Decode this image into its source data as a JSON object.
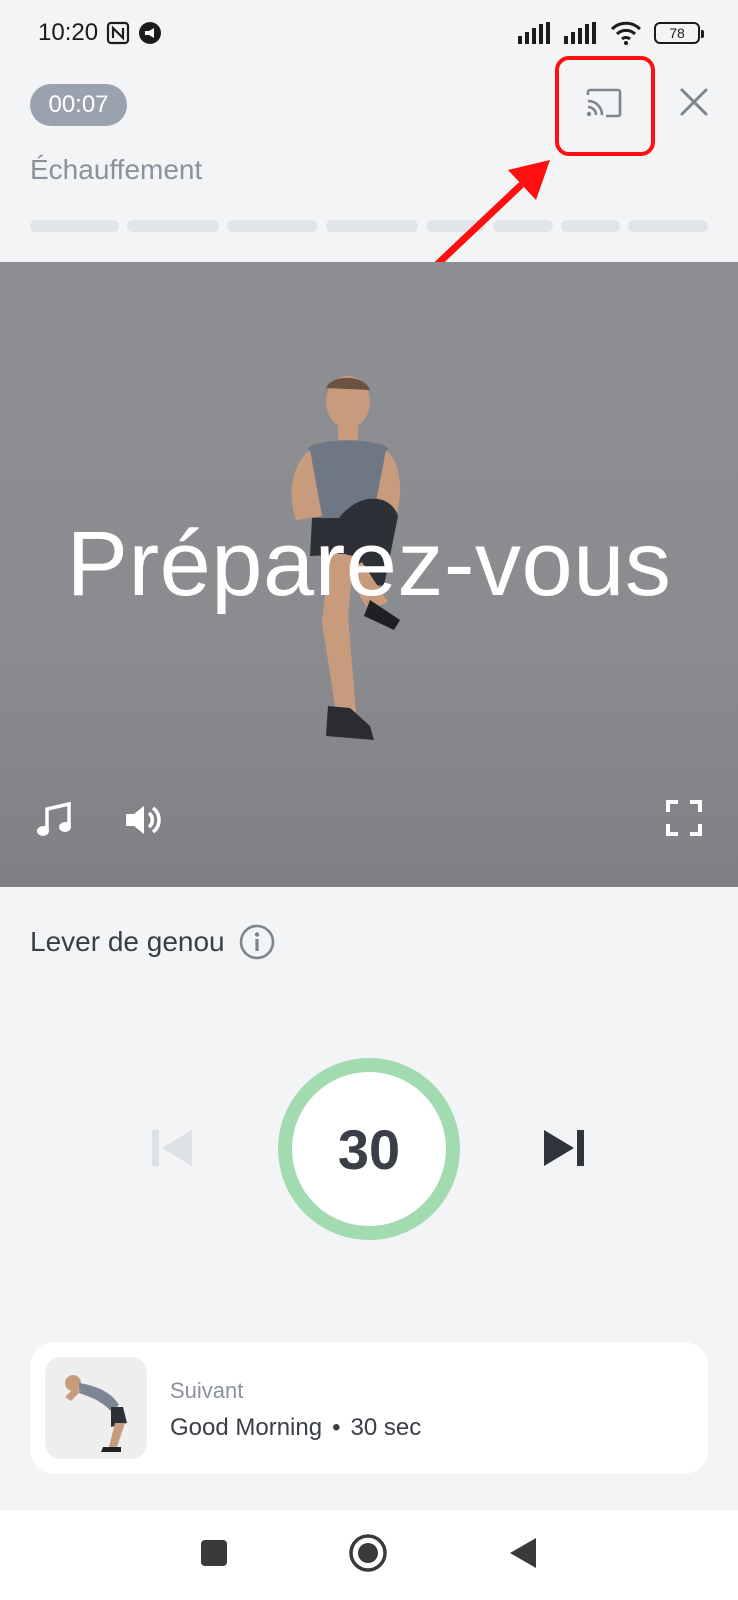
{
  "status_bar": {
    "time": "10:20",
    "battery": "78"
  },
  "header": {
    "timer": "00:07",
    "section": "Échauffement",
    "progress_segments": 8
  },
  "video": {
    "overlay_text": "Préparez-vous"
  },
  "exercise": {
    "name": "Lever de genou"
  },
  "countdown": {
    "value": "30"
  },
  "next": {
    "label": "Suivant",
    "name": "Good Morning",
    "separator": "•",
    "duration": "30 sec"
  },
  "colors": {
    "highlight": "#ff1010",
    "timer_ring": "#a3dbb0",
    "chip": "#9aa2ad"
  }
}
